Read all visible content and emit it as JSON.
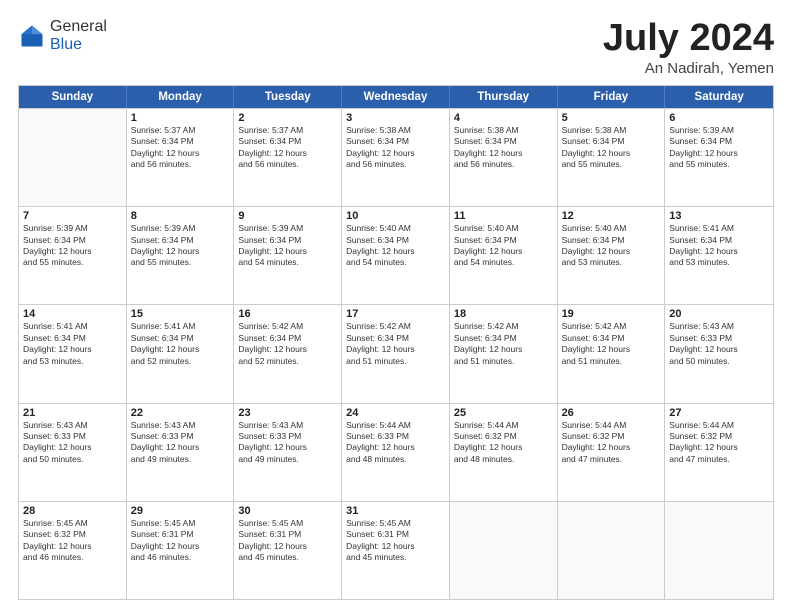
{
  "logo": {
    "general": "General",
    "blue": "Blue"
  },
  "title": "July 2024",
  "location": "An Nadirah, Yemen",
  "header_days": [
    "Sunday",
    "Monday",
    "Tuesday",
    "Wednesday",
    "Thursday",
    "Friday",
    "Saturday"
  ],
  "weeks": [
    [
      {
        "day": "",
        "info": ""
      },
      {
        "day": "1",
        "info": "Sunrise: 5:37 AM\nSunset: 6:34 PM\nDaylight: 12 hours\nand 56 minutes."
      },
      {
        "day": "2",
        "info": "Sunrise: 5:37 AM\nSunset: 6:34 PM\nDaylight: 12 hours\nand 56 minutes."
      },
      {
        "day": "3",
        "info": "Sunrise: 5:38 AM\nSunset: 6:34 PM\nDaylight: 12 hours\nand 56 minutes."
      },
      {
        "day": "4",
        "info": "Sunrise: 5:38 AM\nSunset: 6:34 PM\nDaylight: 12 hours\nand 56 minutes."
      },
      {
        "day": "5",
        "info": "Sunrise: 5:38 AM\nSunset: 6:34 PM\nDaylight: 12 hours\nand 55 minutes."
      },
      {
        "day": "6",
        "info": "Sunrise: 5:39 AM\nSunset: 6:34 PM\nDaylight: 12 hours\nand 55 minutes."
      }
    ],
    [
      {
        "day": "7",
        "info": "Sunrise: 5:39 AM\nSunset: 6:34 PM\nDaylight: 12 hours\nand 55 minutes."
      },
      {
        "day": "8",
        "info": "Sunrise: 5:39 AM\nSunset: 6:34 PM\nDaylight: 12 hours\nand 55 minutes."
      },
      {
        "day": "9",
        "info": "Sunrise: 5:39 AM\nSunset: 6:34 PM\nDaylight: 12 hours\nand 54 minutes."
      },
      {
        "day": "10",
        "info": "Sunrise: 5:40 AM\nSunset: 6:34 PM\nDaylight: 12 hours\nand 54 minutes."
      },
      {
        "day": "11",
        "info": "Sunrise: 5:40 AM\nSunset: 6:34 PM\nDaylight: 12 hours\nand 54 minutes."
      },
      {
        "day": "12",
        "info": "Sunrise: 5:40 AM\nSunset: 6:34 PM\nDaylight: 12 hours\nand 53 minutes."
      },
      {
        "day": "13",
        "info": "Sunrise: 5:41 AM\nSunset: 6:34 PM\nDaylight: 12 hours\nand 53 minutes."
      }
    ],
    [
      {
        "day": "14",
        "info": "Sunrise: 5:41 AM\nSunset: 6:34 PM\nDaylight: 12 hours\nand 53 minutes."
      },
      {
        "day": "15",
        "info": "Sunrise: 5:41 AM\nSunset: 6:34 PM\nDaylight: 12 hours\nand 52 minutes."
      },
      {
        "day": "16",
        "info": "Sunrise: 5:42 AM\nSunset: 6:34 PM\nDaylight: 12 hours\nand 52 minutes."
      },
      {
        "day": "17",
        "info": "Sunrise: 5:42 AM\nSunset: 6:34 PM\nDaylight: 12 hours\nand 51 minutes."
      },
      {
        "day": "18",
        "info": "Sunrise: 5:42 AM\nSunset: 6:34 PM\nDaylight: 12 hours\nand 51 minutes."
      },
      {
        "day": "19",
        "info": "Sunrise: 5:42 AM\nSunset: 6:34 PM\nDaylight: 12 hours\nand 51 minutes."
      },
      {
        "day": "20",
        "info": "Sunrise: 5:43 AM\nSunset: 6:33 PM\nDaylight: 12 hours\nand 50 minutes."
      }
    ],
    [
      {
        "day": "21",
        "info": "Sunrise: 5:43 AM\nSunset: 6:33 PM\nDaylight: 12 hours\nand 50 minutes."
      },
      {
        "day": "22",
        "info": "Sunrise: 5:43 AM\nSunset: 6:33 PM\nDaylight: 12 hours\nand 49 minutes."
      },
      {
        "day": "23",
        "info": "Sunrise: 5:43 AM\nSunset: 6:33 PM\nDaylight: 12 hours\nand 49 minutes."
      },
      {
        "day": "24",
        "info": "Sunrise: 5:44 AM\nSunset: 6:33 PM\nDaylight: 12 hours\nand 48 minutes."
      },
      {
        "day": "25",
        "info": "Sunrise: 5:44 AM\nSunset: 6:32 PM\nDaylight: 12 hours\nand 48 minutes."
      },
      {
        "day": "26",
        "info": "Sunrise: 5:44 AM\nSunset: 6:32 PM\nDaylight: 12 hours\nand 47 minutes."
      },
      {
        "day": "27",
        "info": "Sunrise: 5:44 AM\nSunset: 6:32 PM\nDaylight: 12 hours\nand 47 minutes."
      }
    ],
    [
      {
        "day": "28",
        "info": "Sunrise: 5:45 AM\nSunset: 6:32 PM\nDaylight: 12 hours\nand 46 minutes."
      },
      {
        "day": "29",
        "info": "Sunrise: 5:45 AM\nSunset: 6:31 PM\nDaylight: 12 hours\nand 46 minutes."
      },
      {
        "day": "30",
        "info": "Sunrise: 5:45 AM\nSunset: 6:31 PM\nDaylight: 12 hours\nand 45 minutes."
      },
      {
        "day": "31",
        "info": "Sunrise: 5:45 AM\nSunset: 6:31 PM\nDaylight: 12 hours\nand 45 minutes."
      },
      {
        "day": "",
        "info": ""
      },
      {
        "day": "",
        "info": ""
      },
      {
        "day": "",
        "info": ""
      }
    ]
  ]
}
